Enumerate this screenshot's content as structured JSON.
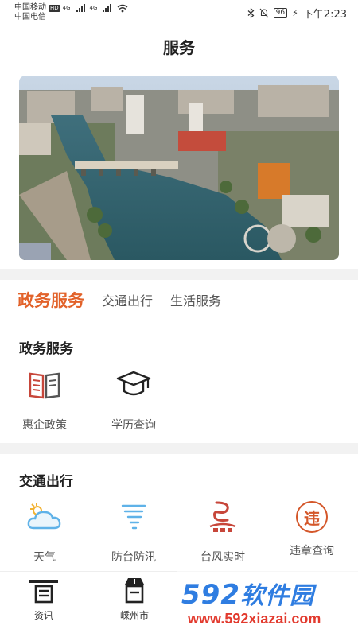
{
  "status_bar": {
    "carrier1": "中国移动",
    "hd": "HD",
    "network1": "4G",
    "network2": "4G",
    "carrier2": "中国电信",
    "battery": "96",
    "time": "下午2:23"
  },
  "header": {
    "title": "服务"
  },
  "banner": {
    "description_icon": "city-river-photo"
  },
  "tabs": [
    {
      "label": "政务服务",
      "active": true
    },
    {
      "label": "交通出行",
      "active": false
    },
    {
      "label": "生活服务",
      "active": false
    }
  ],
  "gov_section": {
    "title": "政务服务",
    "items": [
      {
        "label": "惠企政策",
        "icon": "book-icon"
      },
      {
        "label": "学历查询",
        "icon": "graduation-cap-icon"
      }
    ]
  },
  "traffic_section": {
    "title": "交通出行",
    "items": [
      {
        "label": "天气",
        "icon": "cloud-icon"
      },
      {
        "label": "防台防汛",
        "icon": "tornado-icon"
      },
      {
        "label": "台风实时",
        "icon": "typhoon-icon"
      },
      {
        "label": "违章查询",
        "icon": "violation-icon",
        "glyph": "违"
      }
    ]
  },
  "bottom_nav": [
    {
      "label": "资讯",
      "icon": "news-icon"
    },
    {
      "label": "嵊州市",
      "icon": "city-icon"
    }
  ],
  "watermark": {
    "logo_num": "592",
    "logo_text": "软件园",
    "url": "www.592xiazai.com"
  },
  "colors": {
    "accent": "#e2622a",
    "weather_blue": "#5fb2e8",
    "typhoon_red": "#c7463a"
  }
}
